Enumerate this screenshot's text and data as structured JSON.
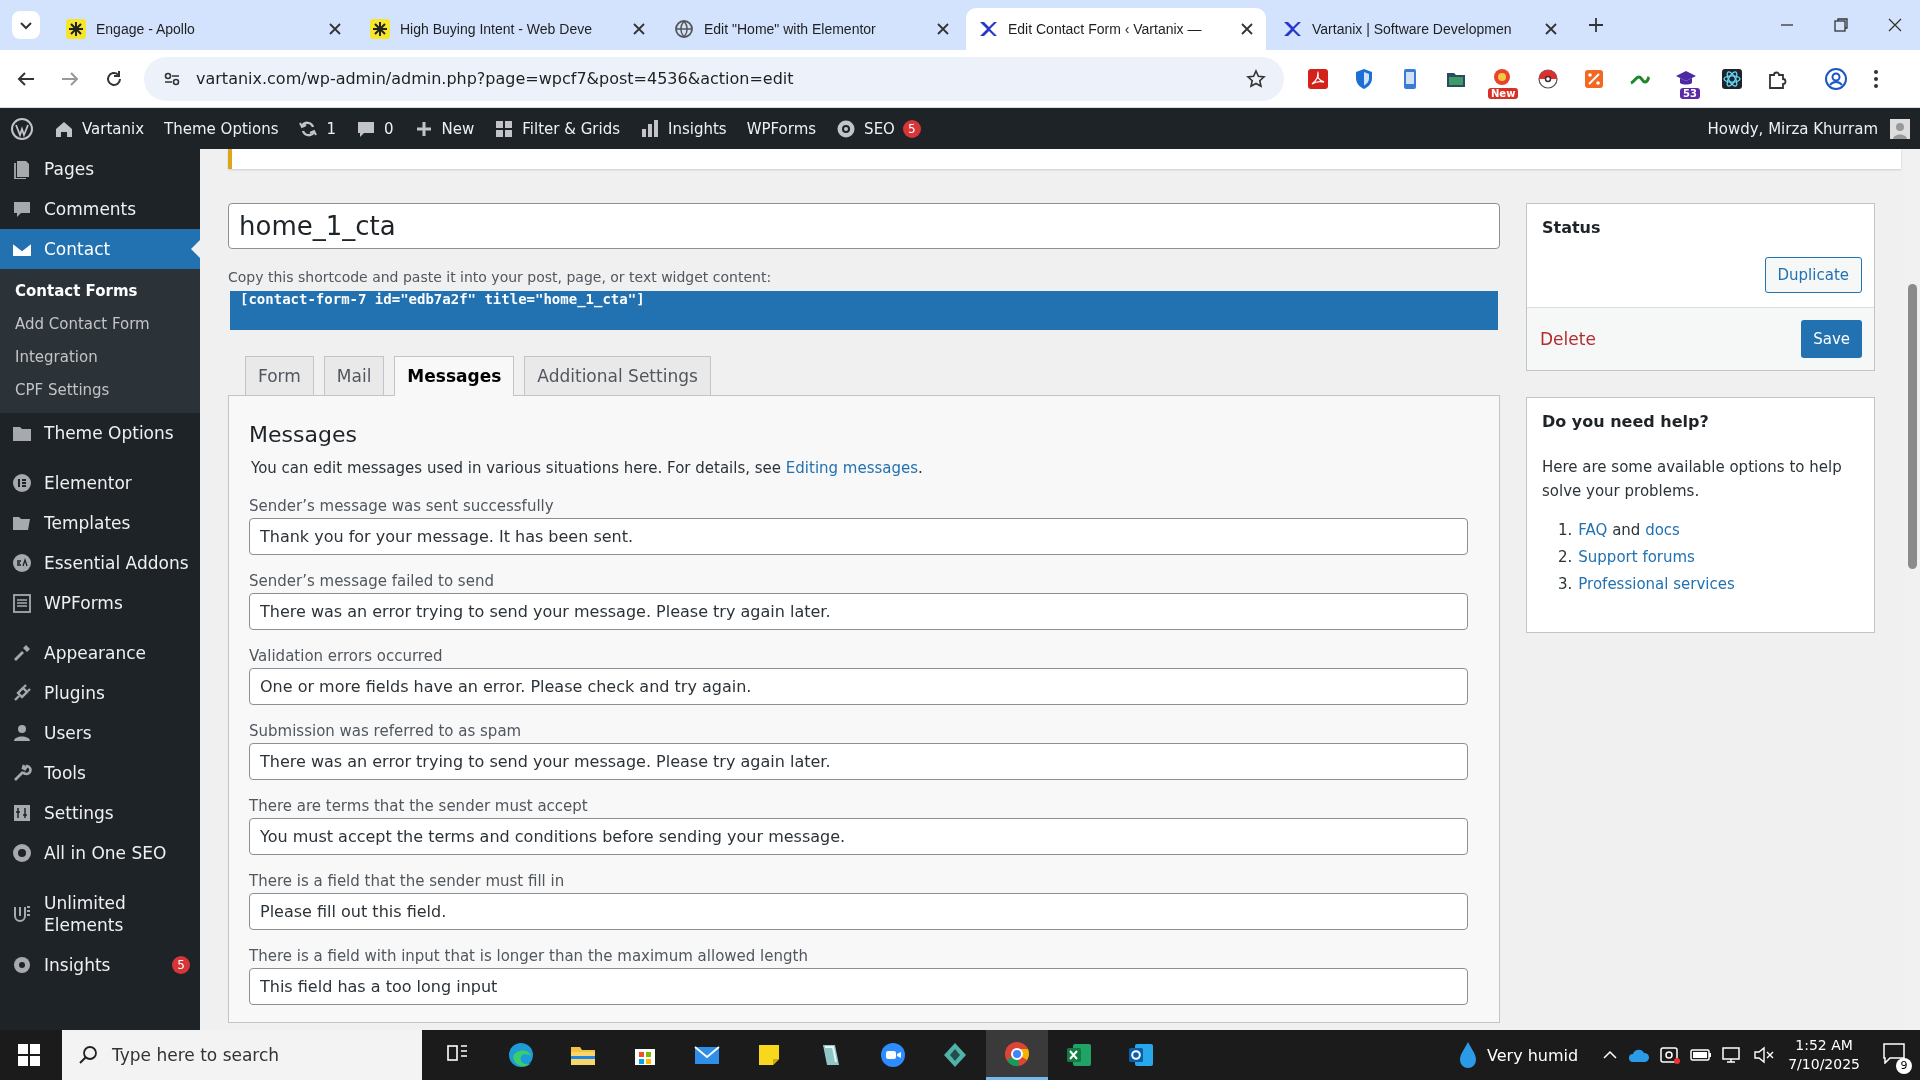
{
  "browser": {
    "tabs": [
      {
        "title": "Engage - Apollo",
        "selected": false
      },
      {
        "title": "High Buying Intent - Web Deve",
        "selected": false
      },
      {
        "title": "Edit \"Home\" with Elementor",
        "selected": false
      },
      {
        "title": "Edit Contact Form ‹ Vartanix —",
        "selected": true
      },
      {
        "title": "Vartanix | Software Developmen",
        "selected": false
      }
    ],
    "address": "vartanix.com/wp-admin/admin.php?page=wpcf7&post=4536&action=edit",
    "extensions": [
      {
        "kind": "pdf"
      },
      {
        "kind": "shield"
      },
      {
        "kind": "phone"
      },
      {
        "kind": "folder"
      },
      {
        "kind": "tag",
        "badge": "New"
      },
      {
        "kind": "ball"
      },
      {
        "kind": "sale"
      },
      {
        "kind": "leaf"
      },
      {
        "kind": "cap",
        "badge": "53"
      },
      {
        "kind": "atom"
      },
      {
        "kind": "puzzle"
      }
    ]
  },
  "admin_bar": {
    "items": [
      {
        "kind": "home",
        "label": "Vartanix"
      },
      {
        "kind": "text",
        "label": "Theme Options"
      },
      {
        "kind": "updates",
        "label": "1"
      },
      {
        "kind": "comments",
        "label": "0"
      },
      {
        "kind": "new",
        "label": "New"
      },
      {
        "kind": "grid",
        "label": "Filter & Grids"
      },
      {
        "kind": "chart",
        "label": "Insights"
      },
      {
        "kind": "text",
        "label": "WPForms"
      },
      {
        "kind": "seo",
        "label": "SEO",
        "badge": "5"
      }
    ],
    "greeting": "Howdy, Mirza Khurram"
  },
  "sidebar": {
    "groups": [
      [
        {
          "label": "Pages",
          "selected": false
        },
        {
          "label": "Comments",
          "selected": false
        },
        {
          "label": "Contact",
          "selected": true,
          "children": [
            {
              "label": "Contact Forms",
              "selected": true
            },
            {
              "label": "Add Contact Form",
              "selected": false
            },
            {
              "label": "Integration",
              "selected": false
            },
            {
              "label": "CPF Settings",
              "selected": false
            }
          ]
        },
        {
          "label": "Theme Options",
          "selected": false
        }
      ],
      [
        {
          "label": "Elementor",
          "selected": false
        },
        {
          "label": "Templates",
          "selected": false
        },
        {
          "label": "Essential Addons",
          "selected": false
        },
        {
          "label": "WPForms",
          "selected": false
        }
      ],
      [
        {
          "label": "Appearance",
          "selected": false
        },
        {
          "label": "Plugins",
          "selected": false
        },
        {
          "label": "Users",
          "selected": false
        },
        {
          "label": "Tools",
          "selected": false
        },
        {
          "label": "Settings",
          "selected": false
        },
        {
          "label": "All in One SEO",
          "selected": false
        }
      ],
      [
        {
          "label": "Unlimited Elements",
          "selected": false
        },
        {
          "label": "Insights",
          "selected": false,
          "badge": "5"
        }
      ]
    ]
  },
  "form": {
    "title": "home_1_cta",
    "shortcode_hint": "Copy this shortcode and paste it into your post, page, or text widget content:",
    "shortcode": "[contact-form-7 id=\"edb7a2f\" title=\"home_1_cta\"]",
    "tabs": [
      {
        "label": "Form",
        "selected": false
      },
      {
        "label": "Mail",
        "selected": false
      },
      {
        "label": "Messages",
        "selected": true
      },
      {
        "label": "Additional Settings",
        "selected": false
      }
    ],
    "panel": {
      "heading": "Messages",
      "intro": "You can edit messages used in various situations here. For details, see ",
      "intro_link": "Editing messages",
      "intro_end": ".",
      "messages": [
        {
          "label": "Sender’s message was sent successfully",
          "value": "Thank you for your message. It has been sent."
        },
        {
          "label": "Sender’s message failed to send",
          "value": "There was an error trying to send your message. Please try again later."
        },
        {
          "label": "Validation errors occurred",
          "value": "One or more fields have an error. Please check and try again."
        },
        {
          "label": "Submission was referred to as spam",
          "value": "There was an error trying to send your message. Please try again later."
        },
        {
          "label": "There are terms that the sender must accept",
          "value": "You must accept the terms and conditions before sending your message."
        },
        {
          "label": "There is a field that the sender must fill in",
          "value": "Please fill out this field."
        },
        {
          "label": "There is a field with input that is longer than the maximum allowed length",
          "value": "This field has a too long input"
        }
      ]
    }
  },
  "status_box": {
    "title": "Status",
    "duplicate": "Duplicate",
    "delete": "Delete",
    "save": "Save"
  },
  "help_box": {
    "title": "Do you need help?",
    "text": "Here are some available options to help solve your problems.",
    "links": [
      {
        "number": "1.",
        "parts": [
          {
            "text": "FAQ",
            "kind": "link"
          },
          {
            "text": " and ",
            "kind": "text"
          },
          {
            "text": "docs",
            "kind": "link"
          }
        ]
      },
      {
        "number": "2.",
        "parts": [
          {
            "text": "Support forums",
            "kind": "link"
          }
        ]
      },
      {
        "number": "3.",
        "parts": [
          {
            "text": "Professional services",
            "kind": "link"
          }
        ]
      }
    ]
  },
  "taskbar": {
    "search_placeholder": "Type here to search",
    "apps": [
      {
        "kind": "taskview",
        "active": false
      },
      {
        "kind": "edge",
        "active": false
      },
      {
        "kind": "files",
        "active": false
      },
      {
        "kind": "store",
        "active": false
      },
      {
        "kind": "mail",
        "active": false
      },
      {
        "kind": "notes",
        "active": false
      },
      {
        "kind": "glass",
        "active": false
      },
      {
        "kind": "zoom",
        "active": false
      },
      {
        "kind": "gem",
        "active": false
      },
      {
        "kind": "chrome",
        "active": true
      },
      {
        "kind": "excel",
        "active": false
      },
      {
        "kind": "outlook",
        "active": false
      }
    ],
    "weather": "Very humid",
    "time": "1:52 AM",
    "date": "7/10/2025",
    "notifications": "9"
  }
}
